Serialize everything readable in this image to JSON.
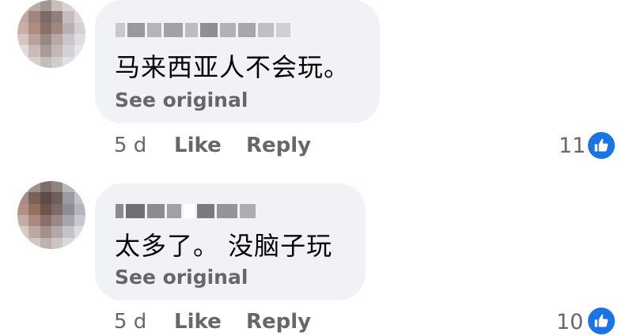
{
  "colors": {
    "bubble": "#f0f2f5",
    "text": "#050505",
    "meta_text": "#65676b",
    "like_blue": "#1b74e4"
  },
  "comments": [
    {
      "author": "",
      "text": "马来西亚人不会玩。",
      "see_original": "See original",
      "time": "5 d",
      "like_label": "Like",
      "reply_label": "Reply",
      "reaction_count": "11",
      "reaction_icon": "thumbs-up-icon"
    },
    {
      "author": "",
      "text": "太多了。 没脑子玩",
      "see_original": "See original",
      "time": "5 d",
      "like_label": "Like",
      "reply_label": "Reply",
      "reaction_count": "10",
      "reaction_icon": "thumbs-up-icon"
    }
  ]
}
